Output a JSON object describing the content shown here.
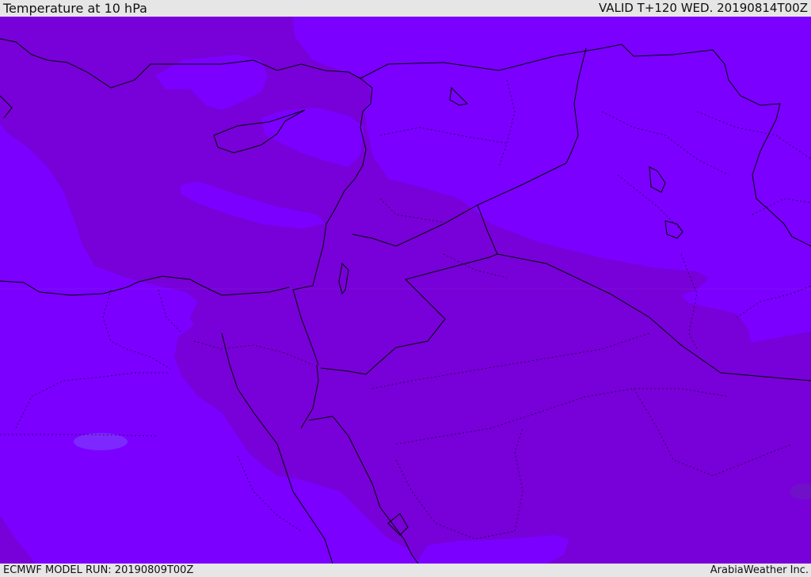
{
  "header": {
    "title": "Temperature at 10 hPa",
    "valid_time": "VALID T+120 WED. 20190814T00Z"
  },
  "footer": {
    "model_run": "ECMWF MODEL RUN: 20190809T00Z",
    "credit": "ArabiaWeather Inc."
  },
  "colors": {
    "warmer_band": "#7800d8",
    "cooler_field": "#7b00ff",
    "warm_spot": "#7010c8",
    "light_patch": "#7d28ff",
    "border_line": "#000000",
    "frame": "#e6e6e6"
  }
}
